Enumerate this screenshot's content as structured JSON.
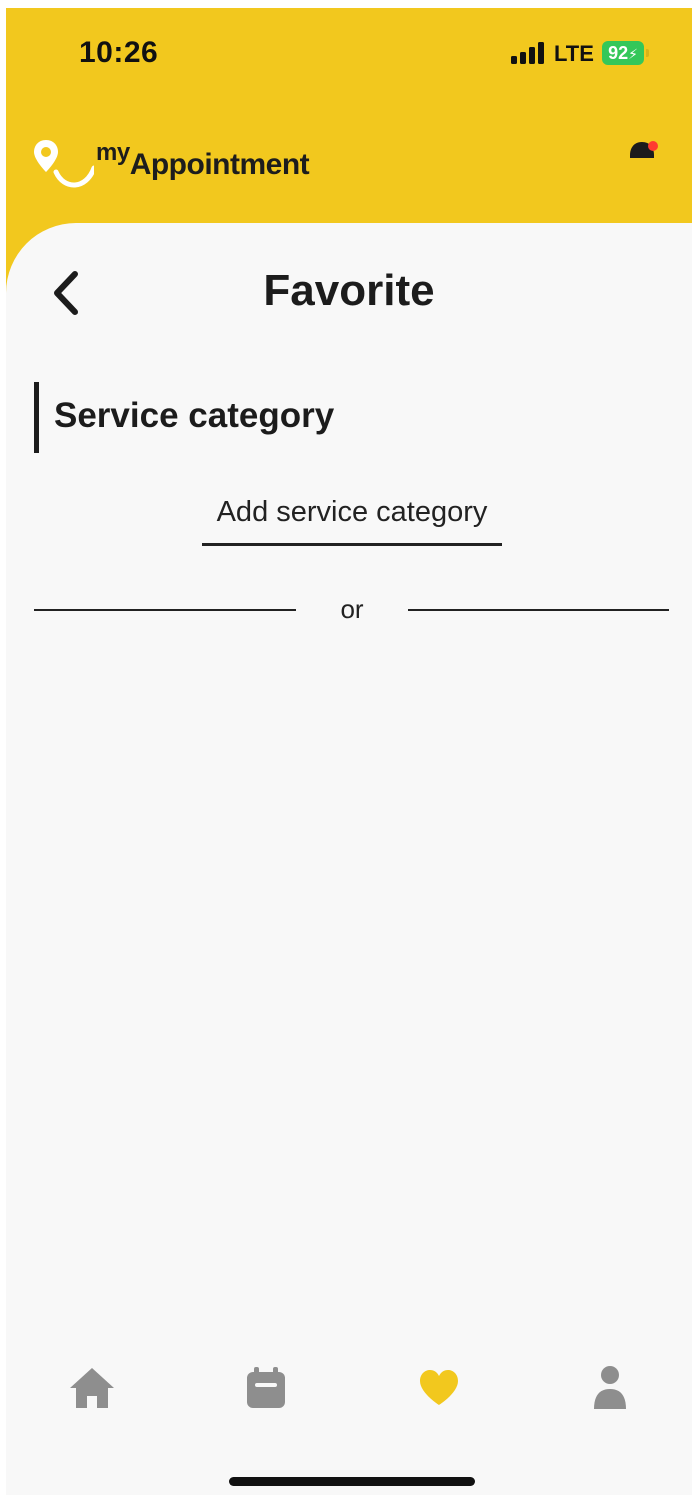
{
  "status_bar": {
    "time": "10:26",
    "network": "LTE",
    "battery": "92"
  },
  "header": {
    "logo_text_my": "my",
    "logo_text_brand": "Appointment",
    "notification_dot_color": "#ff3b30"
  },
  "page": {
    "title": "Favorite",
    "section_title": "Service category",
    "add_link_label": "Add service category",
    "divider_label": "or"
  },
  "tabbar": {
    "items": [
      {
        "icon": "home-icon",
        "active": false
      },
      {
        "icon": "calendar-icon",
        "active": false
      },
      {
        "icon": "heart-icon",
        "active": true
      },
      {
        "icon": "person-icon",
        "active": false
      }
    ]
  },
  "colors": {
    "brand_yellow": "#f2c81e",
    "inactive_icon": "#8e8e8e",
    "active_icon": "#f2c81e"
  }
}
